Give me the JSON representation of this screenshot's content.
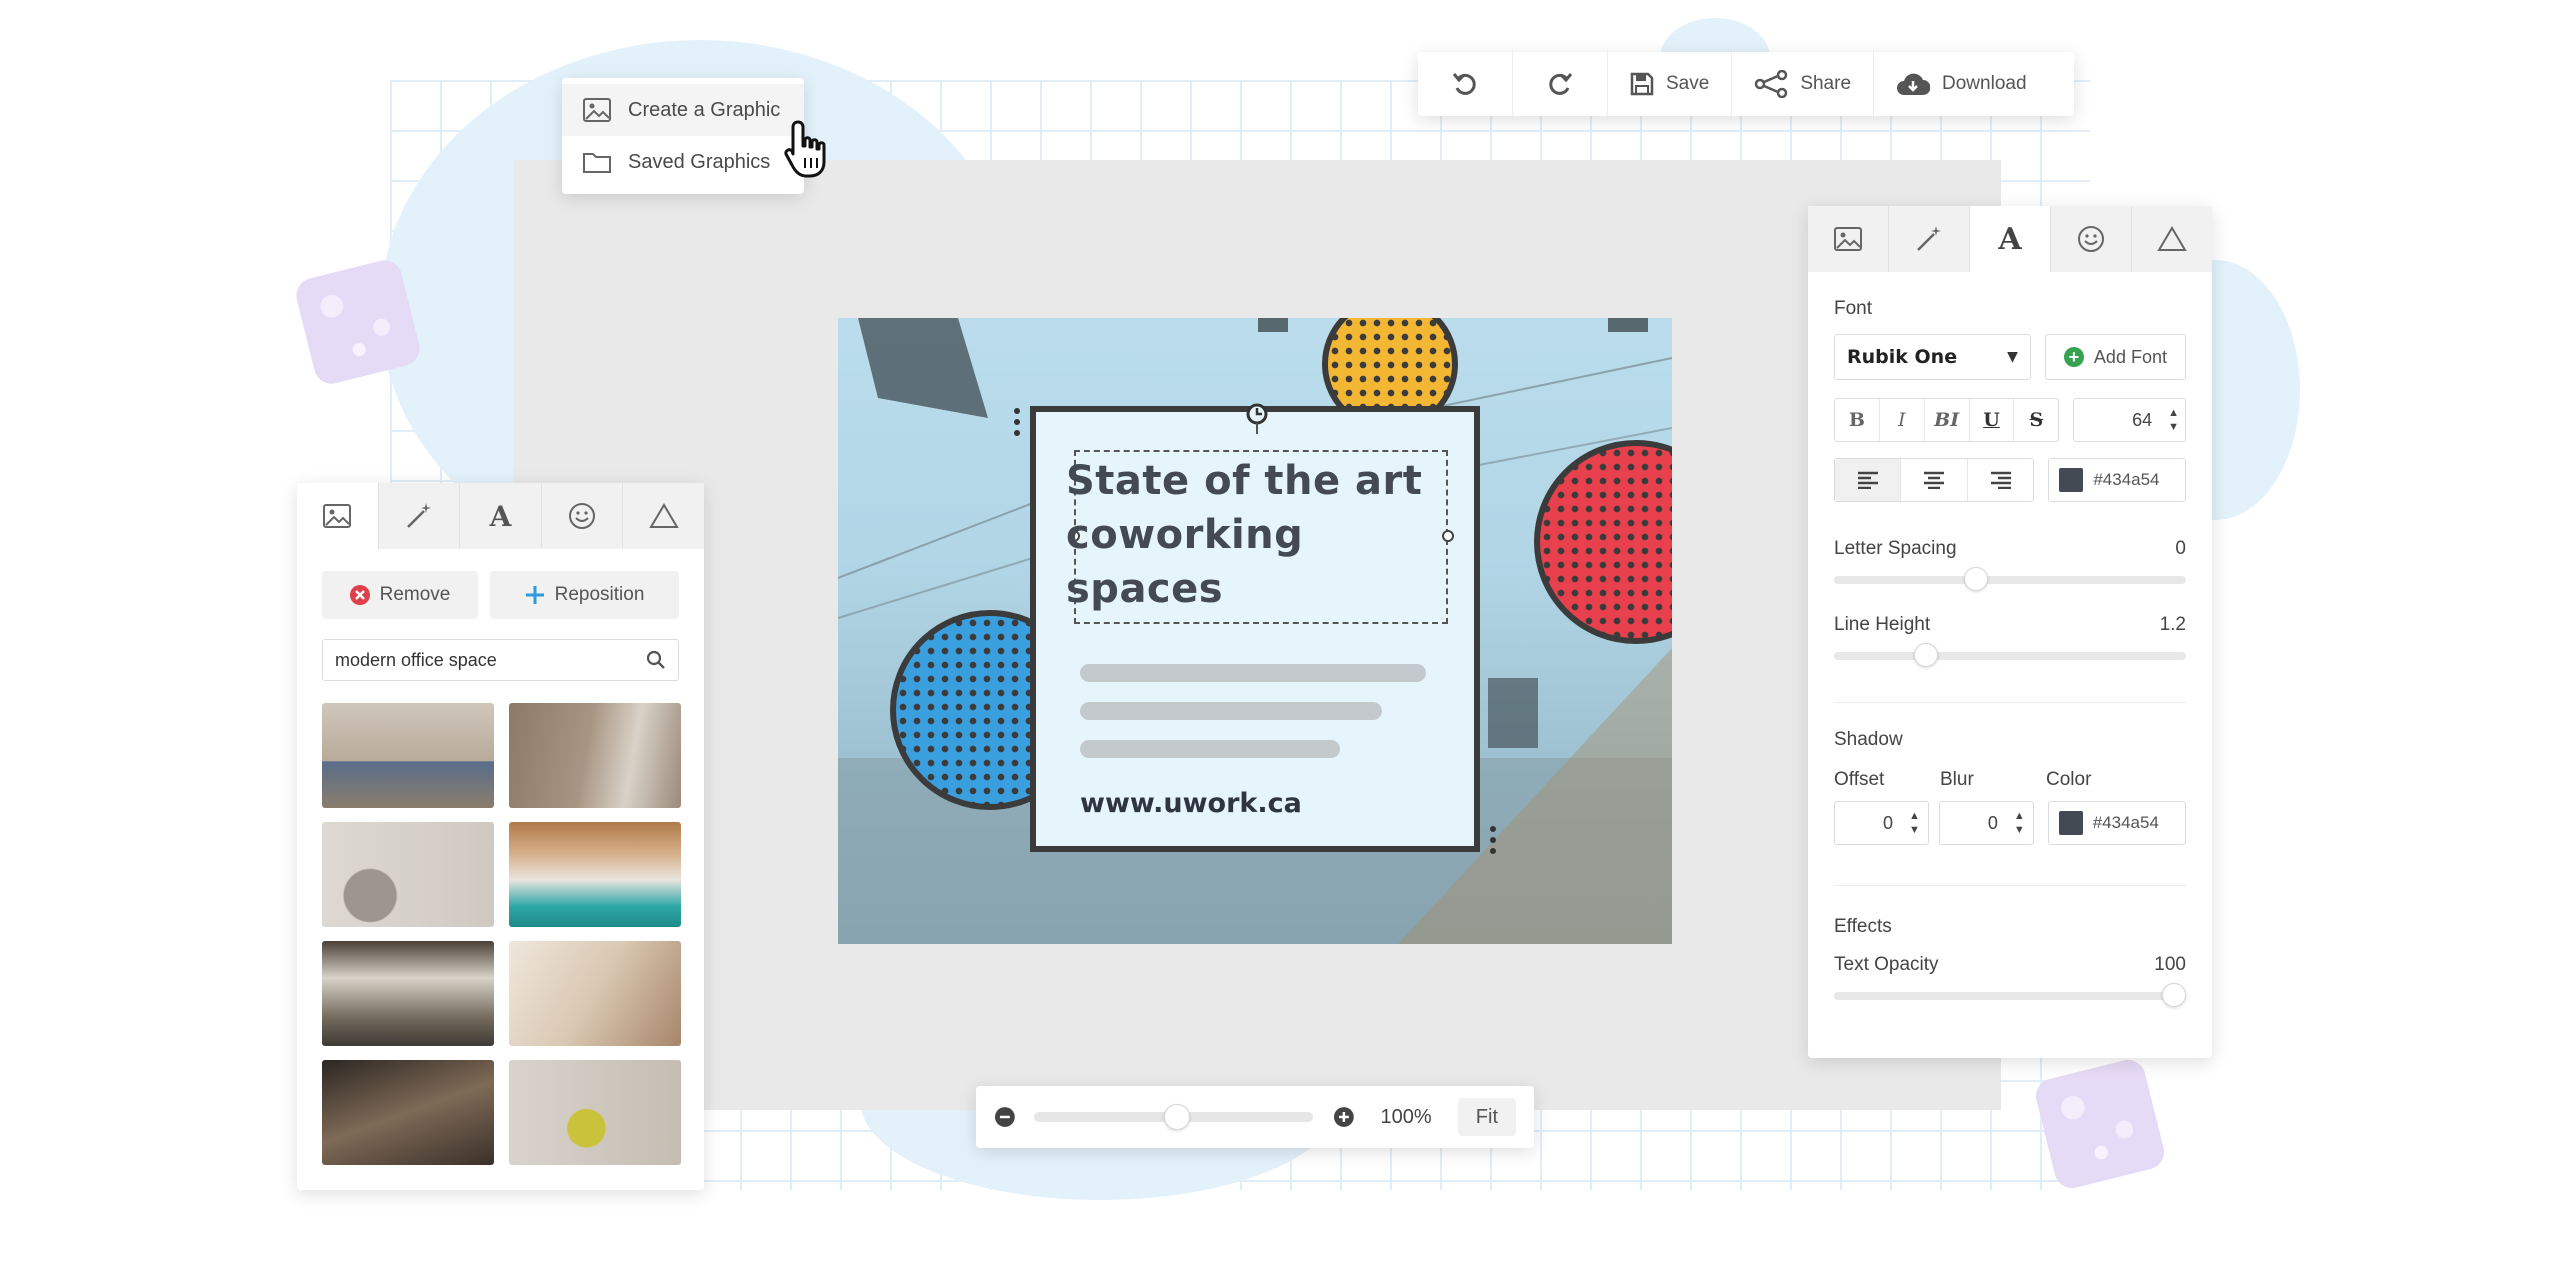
{
  "menu": {
    "items": [
      {
        "label": "Create a Graphic",
        "icon": "image-icon"
      },
      {
        "label": "Saved Graphics",
        "icon": "folder-icon"
      }
    ]
  },
  "toolbar": {
    "undo_icon": "undo-icon",
    "redo_icon": "redo-icon",
    "save_label": "Save",
    "share_label": "Share",
    "download_label": "Download"
  },
  "tabs": [
    "image-icon",
    "magic-wand-icon",
    "text-icon",
    "smiley-icon",
    "triangle-icon"
  ],
  "left_panel": {
    "remove_label": "Remove",
    "reposition_label": "Reposition",
    "search_value": "modern office space",
    "thumbnail_count_note": "8 photo results"
  },
  "design": {
    "title": "State of the art coworking spaces",
    "url": "www.uwork.ca",
    "colors": {
      "yellow": "#f3b733",
      "red": "#e8404d",
      "blue": "#3a9fde",
      "ink": "#3b3b3b",
      "card": "#e6f4fb"
    }
  },
  "zoom": {
    "value": "100%",
    "level": 0.5,
    "fit_label": "Fit"
  },
  "right_panel": {
    "font_label": "Font",
    "font_value": "Rubik One",
    "add_font_label": "Add Font",
    "style_buttons": [
      "B",
      "I",
      "BI",
      "U",
      "S"
    ],
    "font_size": "64",
    "text_color": "#434a54",
    "letter_spacing_label": "Letter Spacing",
    "letter_spacing_value": "0",
    "line_height_label": "Line Height",
    "line_height_value": "1.2",
    "shadow_label": "Shadow",
    "offset_label": "Offset",
    "blur_label": "Blur",
    "color_label": "Color",
    "offset_value": "0",
    "blur_value": "0",
    "shadow_color": "#434a54",
    "effects_label": "Effects",
    "text_opacity_label": "Text Opacity",
    "text_opacity_value": "100"
  }
}
